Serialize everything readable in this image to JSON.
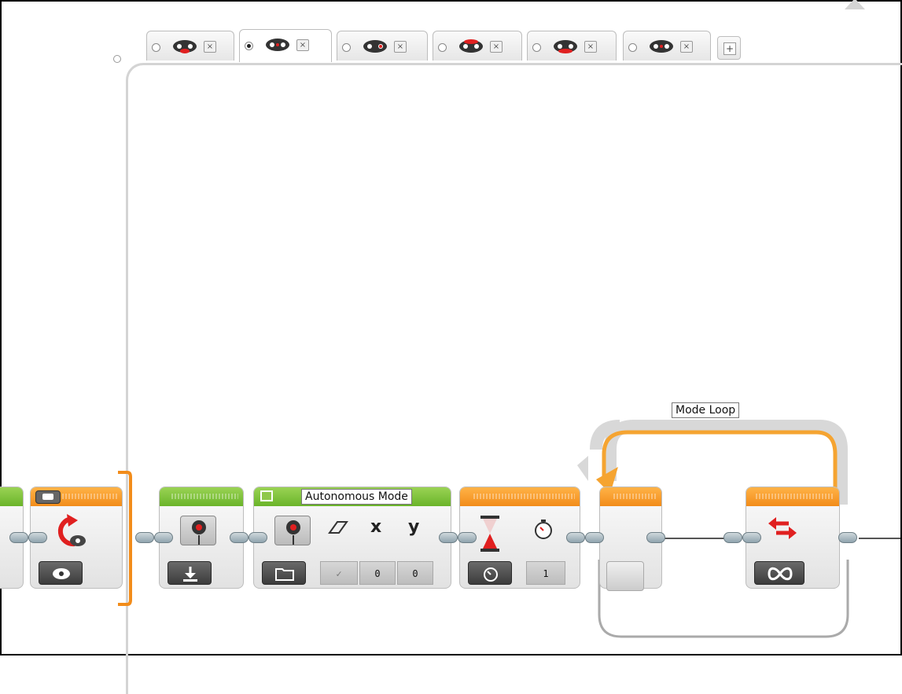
{
  "tabs": [
    {
      "label": "",
      "selected": false,
      "icon": "ev3-brick-icon"
    },
    {
      "label": "",
      "selected": true,
      "icon": "ev3-brick-icon"
    },
    {
      "label": "",
      "selected": false,
      "icon": "ev3-brick-icon"
    },
    {
      "label": "",
      "selected": false,
      "icon": "ev3-brick-icon"
    },
    {
      "label": "",
      "selected": false,
      "icon": "ev3-brick-icon"
    },
    {
      "label": "",
      "selected": false,
      "icon": "ev3-brick-icon"
    }
  ],
  "add_tab": {
    "icon": "plus-icon",
    "label": "+"
  },
  "tab_close": {
    "label": "×"
  },
  "blocks": {
    "display_block": {
      "title": "Autonomous Mode"
    },
    "wait_block": {
      "seconds": "1"
    },
    "display_params": {
      "x": "0",
      "y": "0",
      "x_label": "x",
      "y_label": "y"
    },
    "loop": {
      "name": "Mode Loop",
      "end_icon": "infinity-icon"
    }
  },
  "colors": {
    "green": "#6ab42a",
    "orange": "#f28c1a",
    "loop": "#f5a431",
    "red": "#e02020"
  }
}
